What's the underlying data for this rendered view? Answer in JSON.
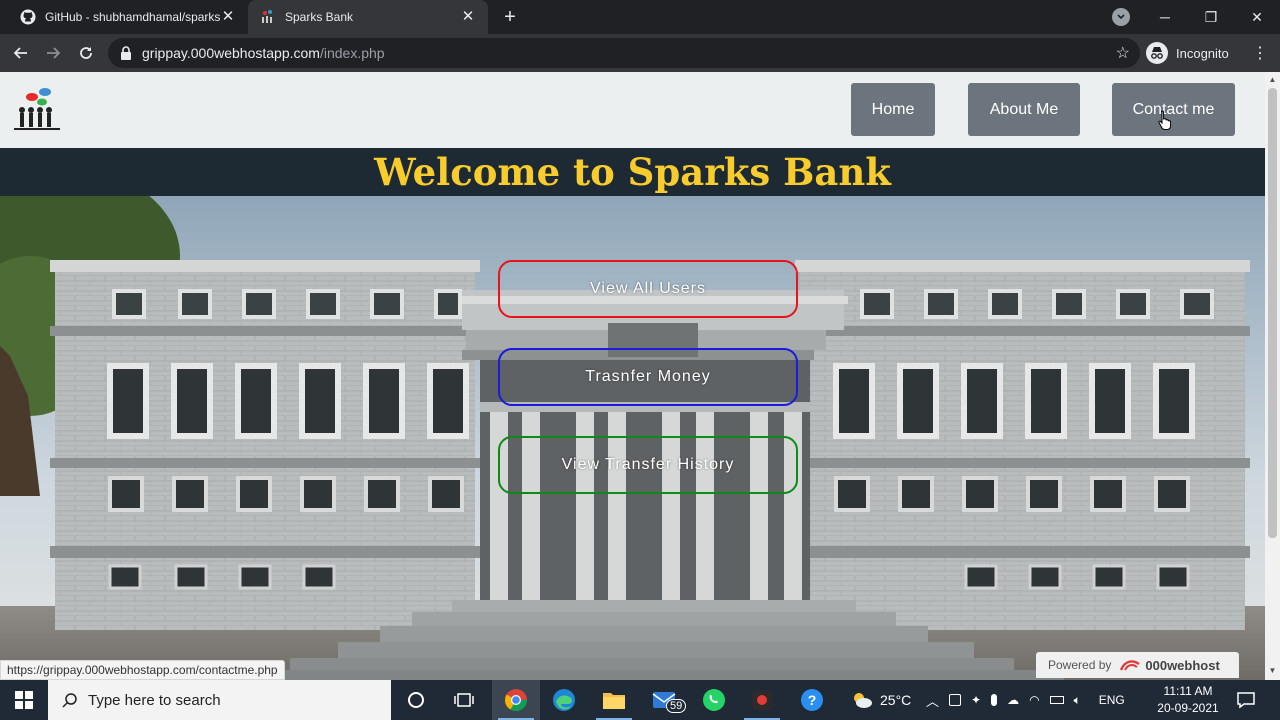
{
  "browser": {
    "tabs": [
      {
        "title": "GitHub - shubhamdhamal/sparks",
        "active": false
      },
      {
        "title": "Sparks Bank",
        "active": true
      }
    ],
    "new_tab_glyph": "+",
    "url_host": "grippay.000webhostapp.com",
    "url_path": "/index.php",
    "profile_label": "Incognito",
    "status_url": "https://grippay.000webhostapp.com/contactme.php"
  },
  "page": {
    "nav": {
      "items": [
        {
          "label": "Home"
        },
        {
          "label": "About Me"
        },
        {
          "label": "Contact me"
        }
      ]
    },
    "welcome": "Welcome to Sparks Bank",
    "actions": [
      {
        "label": "View All Users",
        "color": "#e8141c"
      },
      {
        "label": "Trasnfer Money",
        "color": "#1b1bdc"
      },
      {
        "label": "View Transfer History",
        "color": "#0e8a17"
      }
    ],
    "powered_by": "Powered by",
    "powered_brand": "000webhost"
  },
  "taskbar": {
    "search_placeholder": "Type here to search",
    "mail_badge": "59",
    "weather": "25°C",
    "language": "ENG",
    "time": "11:11 AM",
    "date": "20-09-2021"
  }
}
